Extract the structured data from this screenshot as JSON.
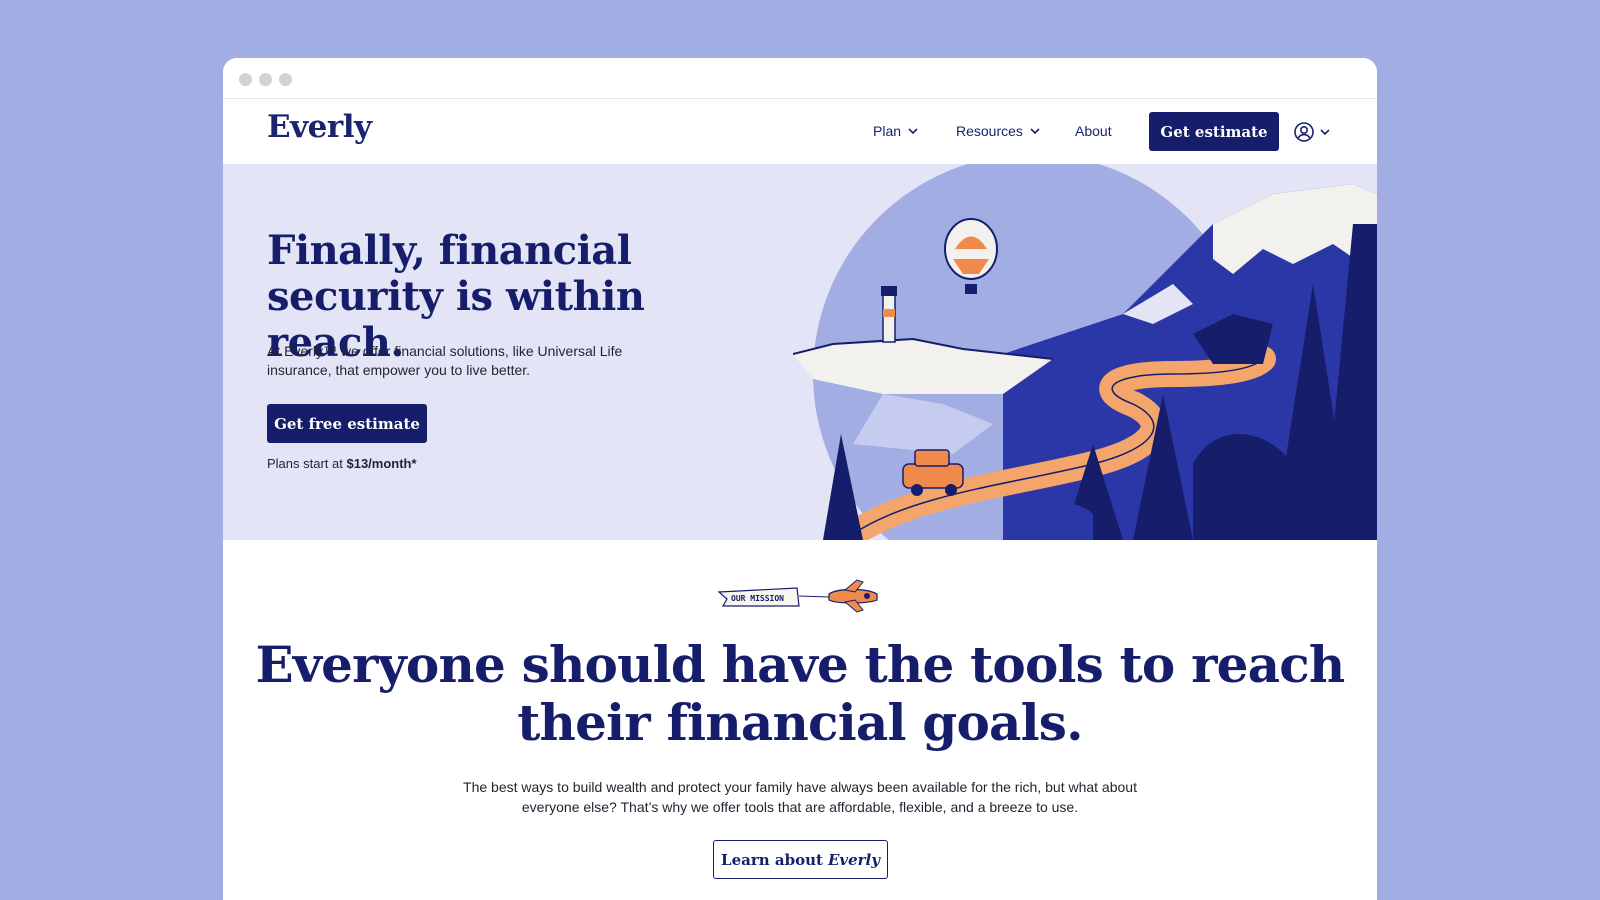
{
  "colors": {
    "background": "#a2aee3",
    "navy": "#161e6b",
    "hero_bg": "#e3e5f7",
    "accent_orange": "#f08a4b"
  },
  "nav": {
    "logo": "Everly",
    "items": [
      {
        "label": "Plan",
        "icon": "chevron-down-icon"
      },
      {
        "label": "Resources",
        "icon": "chevron-down-icon"
      },
      {
        "label": "About"
      }
    ],
    "cta_label": "Get estimate",
    "account_icon": "user-circle-icon"
  },
  "hero": {
    "title": "Finally, financial security is within reach.",
    "subtitle": "At Everly™ we offer financial solutions, like Universal Life insurance, that empower you to live better.",
    "cta_label": "Get free estimate",
    "price_prefix": "Plans start at ",
    "price_value": "$13/month*"
  },
  "mission": {
    "banner_text": "OUR MISSION",
    "title": "Everyone should have the tools to reach their financial goals.",
    "body": "The best ways to build wealth and protect your family have always been available for the rich, but what about everyone else? That’s why we offer tools that are affordable, flexible, and a breeze to use.",
    "cta_prefix": "Learn about",
    "cta_brand": "Everly"
  }
}
